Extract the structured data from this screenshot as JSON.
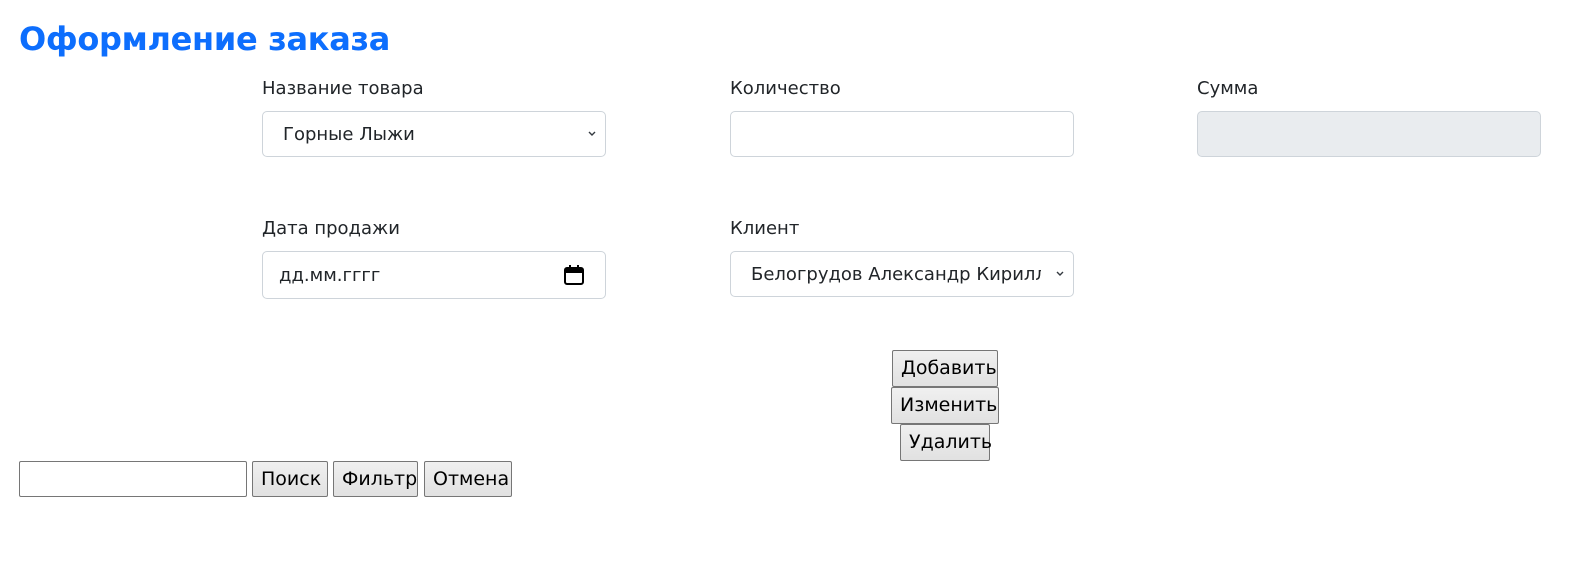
{
  "page": {
    "title": "Оформление заказа"
  },
  "form": {
    "product": {
      "label": "Название товара",
      "value": "Горные Лыжи"
    },
    "quantity": {
      "label": "Количество",
      "value": ""
    },
    "sum": {
      "label": "Сумма",
      "value": ""
    },
    "sale_date": {
      "label": "Дата продажи",
      "placeholder": "дд.мм.гггг"
    },
    "client": {
      "label": "Клиент",
      "value": "Белогрудов Александр Кирилло"
    }
  },
  "actions": {
    "add": "Добавить",
    "edit": "Изменить",
    "delete": "Удалить"
  },
  "search": {
    "value": "",
    "search_label": "Поиск",
    "filter_label": "Фильтр",
    "cancel_label": "Отмена"
  },
  "icons": {
    "select_chevron": "chevron-down-icon",
    "date_picker": "calendar-icon"
  },
  "colors": {
    "title": "#0d6efd",
    "input_border": "#ced4da",
    "disabled_bg": "#e9ecef"
  }
}
